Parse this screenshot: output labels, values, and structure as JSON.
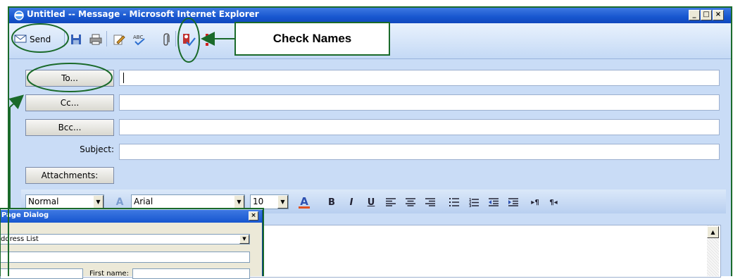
{
  "window": {
    "title": "Untitled -- Message - Microsoft Internet Explorer",
    "controls": {
      "minimize": "_",
      "maximize": "□",
      "close": "×"
    }
  },
  "toolbar": {
    "send_label": "Send",
    "icons": [
      "save-icon",
      "print-icon",
      "edit-icon",
      "spellcheck-icon",
      "attach-icon",
      "check-names-icon",
      "priority-icon"
    ]
  },
  "recipients": {
    "to_label": "To...",
    "cc_label": "Cc...",
    "bcc_label": "Bcc...",
    "subject_label": "Subject:",
    "attachments_label": "Attachments:",
    "to_value": "",
    "cc_value": "",
    "bcc_value": "",
    "subject_value": ""
  },
  "format_bar": {
    "style": "Normal",
    "font": "Arial",
    "size": "10",
    "font_color_glyph": "A",
    "buttons": [
      "B",
      "I",
      "U"
    ]
  },
  "dialog": {
    "title": "Page Dialog",
    "close": "×",
    "list_label": "ddress List",
    "first_name_label": "First name:"
  },
  "annotation": {
    "callout": "Check Names",
    "accent_color": "#1a6a2a"
  }
}
